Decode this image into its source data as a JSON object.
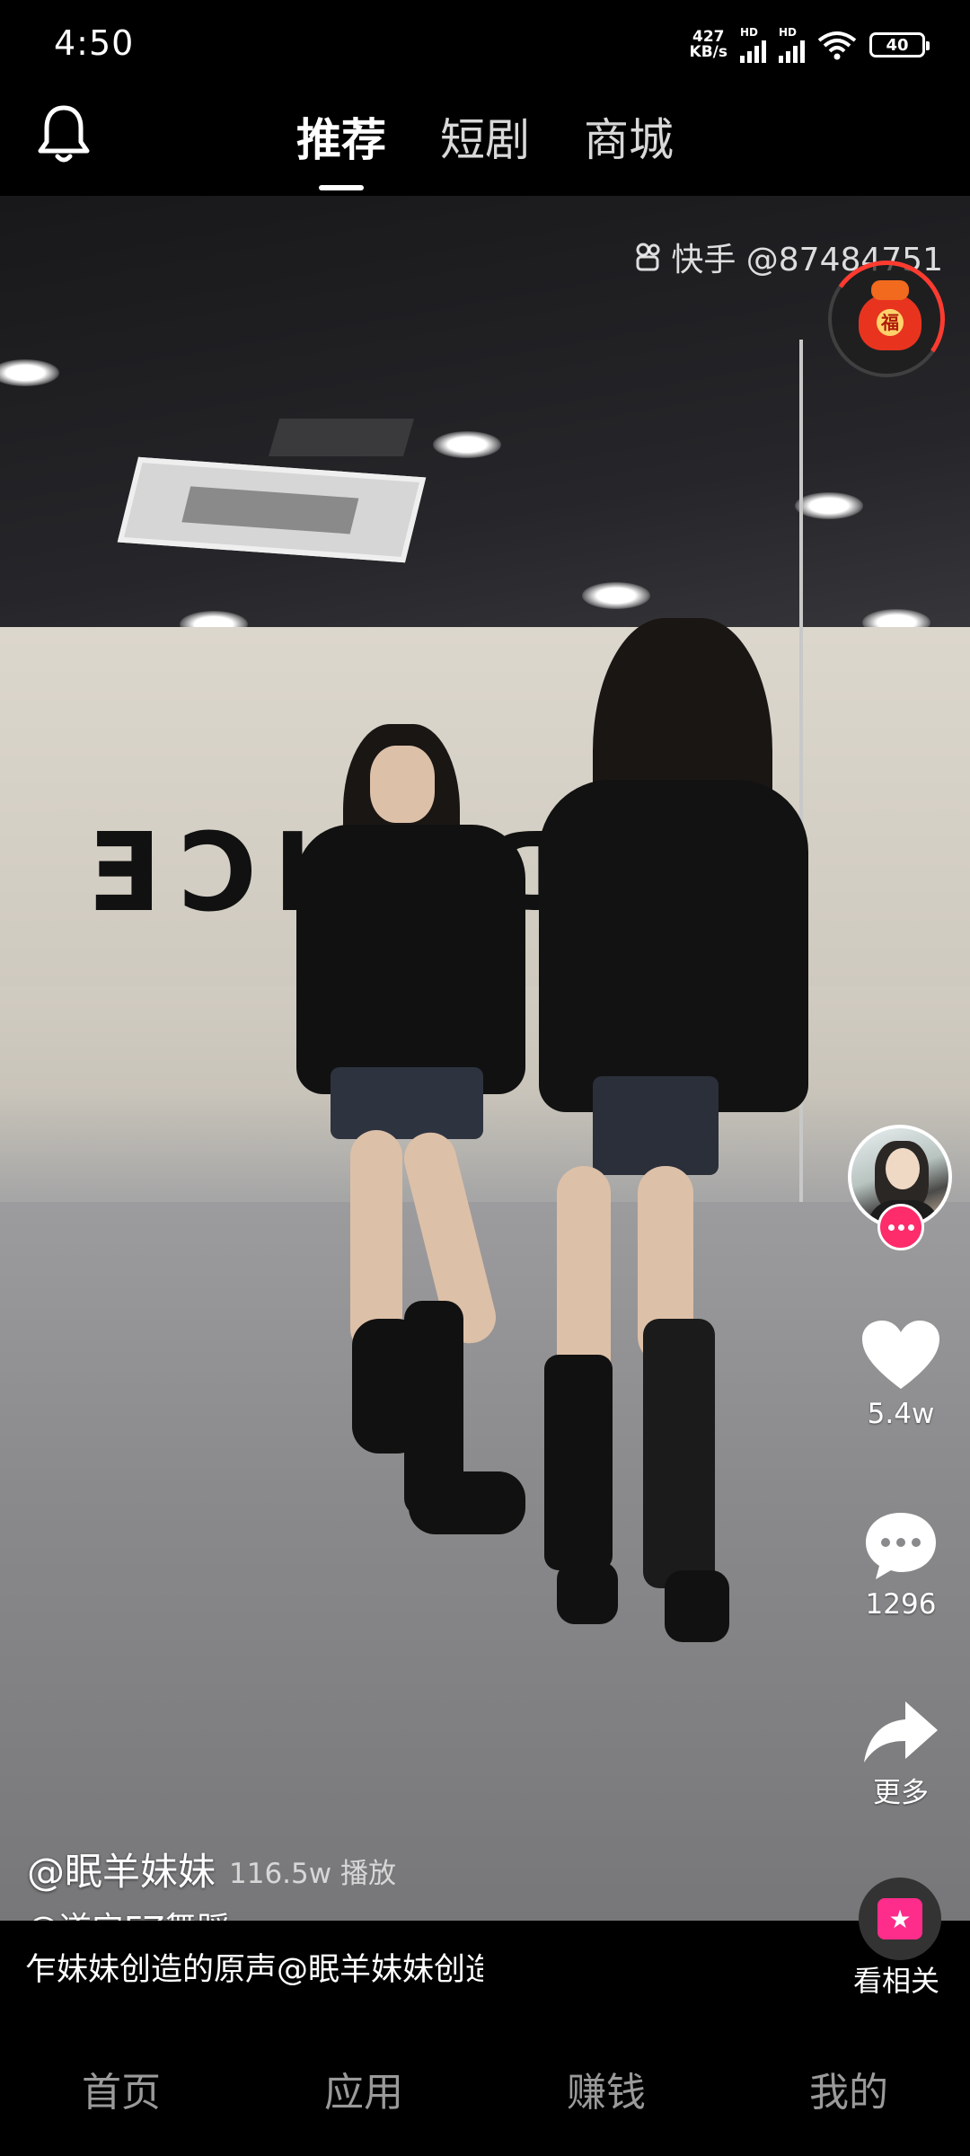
{
  "status_bar": {
    "time": "4:50",
    "net_speed_value": "427",
    "net_speed_unit": "KB/s",
    "signal1_label": "HD",
    "signal2_label": "HD",
    "battery": "40"
  },
  "top_nav": {
    "tabs": [
      {
        "label": "推荐",
        "active": true
      },
      {
        "label": "短剧",
        "active": false
      },
      {
        "label": "商城",
        "active": false
      }
    ]
  },
  "video": {
    "watermark": "快手 @87484751",
    "wall_text": "DANCE",
    "red_packet_char": "福"
  },
  "actions": {
    "like_count": "5.4w",
    "comment_count": "1296",
    "share_label": "更多",
    "related_label": "看相关"
  },
  "post": {
    "author": "@眠羊妹妹",
    "plays": "116.5w 播放",
    "mention": "@遂宁FZ舞蹈",
    "music": "乍妹妹创造的原声@眠羊妹妹创造"
  },
  "bottom_nav": {
    "items": [
      "首页",
      "应用",
      "赚钱",
      "我的"
    ]
  },
  "colors": {
    "accent_pink": "#fe2c6b",
    "red_packet": "#e8341f"
  }
}
